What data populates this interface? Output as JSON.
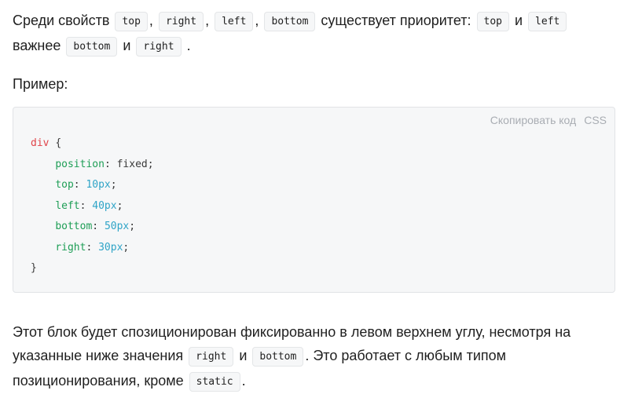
{
  "para1": {
    "t1": "Среди свойств ",
    "c_top": "top",
    "sep1": ",",
    "c_right": "right",
    "sep2": ",",
    "c_left": "left",
    "sep3": ",",
    "c_bottom": "bottom",
    "t2": " существует приоритет: ",
    "c_top2": "top",
    "t3": " и ",
    "c_left2": "left",
    "t4": "важнее ",
    "c_bottom2": "bottom",
    "t5": " и ",
    "c_right2": "right",
    "t6": "."
  },
  "para2": {
    "text": "Пример:"
  },
  "code_block": {
    "copy_label": "Скопировать код",
    "lang_label": "CSS",
    "selector": "div",
    "open_brace": "{",
    "close_brace": "}",
    "decls": [
      {
        "prop": "position",
        "value": "fixed",
        "num": ""
      },
      {
        "prop": "top",
        "value": "",
        "num": "10px"
      },
      {
        "prop": "left",
        "value": "",
        "num": "40px"
      },
      {
        "prop": "bottom",
        "value": "",
        "num": "50px"
      },
      {
        "prop": "right",
        "value": "",
        "num": "30px"
      }
    ]
  },
  "para3": {
    "t1": "Этот блок будет спозиционирован фиксированно в левом верхнем углу, несмотря на указанные ниже значения ",
    "c_right": "right",
    "t2": " и ",
    "c_bottom": "bottom",
    "t3": ". Это работает с любым типом позиционирования, кроме ",
    "c_static": "static",
    "t4": "."
  }
}
